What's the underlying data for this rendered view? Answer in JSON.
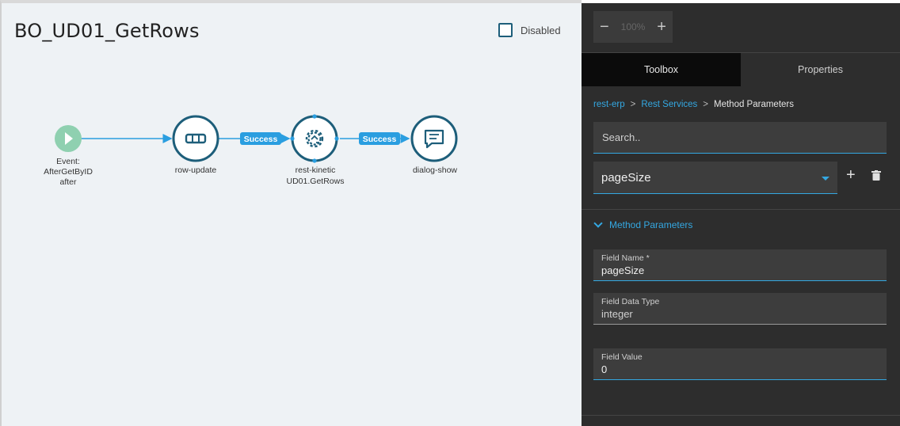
{
  "flow": {
    "title": "BO_UD01_GetRows",
    "disabled_label": "Disabled",
    "nodes": [
      {
        "id": "event",
        "icon": "play-icon",
        "label_lines": [
          "Event:",
          "AfterGetByID",
          "after"
        ]
      },
      {
        "id": "row-update",
        "icon": "row-update-icon",
        "label_lines": [
          "row-update"
        ]
      },
      {
        "id": "rest-kinetic",
        "icon": "rest-gear-icon",
        "label_lines": [
          "rest-kinetic",
          "UD01.GetRows"
        ]
      },
      {
        "id": "dialog-show",
        "icon": "dialog-icon",
        "label_lines": [
          "dialog-show"
        ]
      }
    ],
    "edges": [
      {
        "from": "event",
        "to": "row-update",
        "label": ""
      },
      {
        "from": "row-update",
        "to": "rest-kinetic",
        "label": "Success"
      },
      {
        "from": "rest-kinetic",
        "to": "dialog-show",
        "label": "Success"
      }
    ]
  },
  "panel": {
    "zoom": {
      "value": "100%",
      "minus": "−",
      "plus": "+"
    },
    "tabs": [
      {
        "label": "Toolbox",
        "active": true
      },
      {
        "label": "Properties",
        "active": false
      }
    ],
    "breadcrumb": {
      "items": [
        "rest-erp",
        "Rest Services"
      ],
      "current": "Method Parameters",
      "separator": ">"
    },
    "search": {
      "placeholder": "Search.."
    },
    "method_select": {
      "value": "pageSize"
    },
    "add_label": "+",
    "section": {
      "title": "Method Parameters"
    },
    "fields": {
      "name": {
        "label": "Field Name *",
        "value": "pageSize"
      },
      "type": {
        "label": "Field Data Type",
        "value": "integer"
      },
      "value": {
        "label": "Field Value",
        "value": "0"
      }
    }
  },
  "colors": {
    "node_stroke": "#1d5e7a",
    "event_fill": "#8fd0b0",
    "edge": "#2a9ee0",
    "accent": "#34a8e2",
    "panel_bg": "#2d2d2d"
  }
}
